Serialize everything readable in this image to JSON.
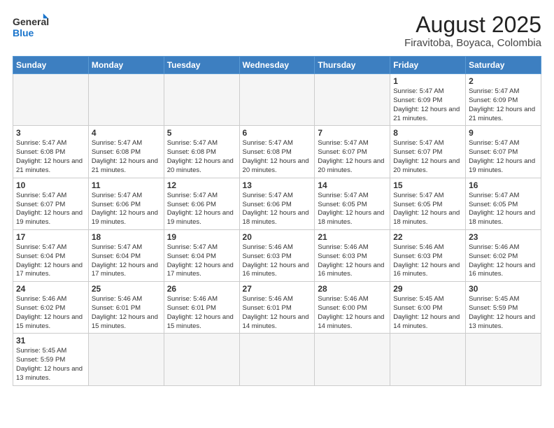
{
  "logo": {
    "text_general": "General",
    "text_blue": "Blue"
  },
  "header": {
    "title": "August 2025",
    "subtitle": "Firavitoba, Boyaca, Colombia"
  },
  "weekdays": [
    "Sunday",
    "Monday",
    "Tuesday",
    "Wednesday",
    "Thursday",
    "Friday",
    "Saturday"
  ],
  "weeks": [
    [
      {
        "day": "",
        "info": "",
        "empty": true
      },
      {
        "day": "",
        "info": "",
        "empty": true
      },
      {
        "day": "",
        "info": "",
        "empty": true
      },
      {
        "day": "",
        "info": "",
        "empty": true
      },
      {
        "day": "",
        "info": "",
        "empty": true
      },
      {
        "day": "1",
        "info": "Sunrise: 5:47 AM\nSunset: 6:09 PM\nDaylight: 12 hours\nand 21 minutes."
      },
      {
        "day": "2",
        "info": "Sunrise: 5:47 AM\nSunset: 6:09 PM\nDaylight: 12 hours\nand 21 minutes."
      }
    ],
    [
      {
        "day": "3",
        "info": "Sunrise: 5:47 AM\nSunset: 6:08 PM\nDaylight: 12 hours\nand 21 minutes."
      },
      {
        "day": "4",
        "info": "Sunrise: 5:47 AM\nSunset: 6:08 PM\nDaylight: 12 hours\nand 21 minutes."
      },
      {
        "day": "5",
        "info": "Sunrise: 5:47 AM\nSunset: 6:08 PM\nDaylight: 12 hours\nand 20 minutes."
      },
      {
        "day": "6",
        "info": "Sunrise: 5:47 AM\nSunset: 6:08 PM\nDaylight: 12 hours\nand 20 minutes."
      },
      {
        "day": "7",
        "info": "Sunrise: 5:47 AM\nSunset: 6:07 PM\nDaylight: 12 hours\nand 20 minutes."
      },
      {
        "day": "8",
        "info": "Sunrise: 5:47 AM\nSunset: 6:07 PM\nDaylight: 12 hours\nand 20 minutes."
      },
      {
        "day": "9",
        "info": "Sunrise: 5:47 AM\nSunset: 6:07 PM\nDaylight: 12 hours\nand 19 minutes."
      }
    ],
    [
      {
        "day": "10",
        "info": "Sunrise: 5:47 AM\nSunset: 6:07 PM\nDaylight: 12 hours\nand 19 minutes."
      },
      {
        "day": "11",
        "info": "Sunrise: 5:47 AM\nSunset: 6:06 PM\nDaylight: 12 hours\nand 19 minutes."
      },
      {
        "day": "12",
        "info": "Sunrise: 5:47 AM\nSunset: 6:06 PM\nDaylight: 12 hours\nand 19 minutes."
      },
      {
        "day": "13",
        "info": "Sunrise: 5:47 AM\nSunset: 6:06 PM\nDaylight: 12 hours\nand 18 minutes."
      },
      {
        "day": "14",
        "info": "Sunrise: 5:47 AM\nSunset: 6:05 PM\nDaylight: 12 hours\nand 18 minutes."
      },
      {
        "day": "15",
        "info": "Sunrise: 5:47 AM\nSunset: 6:05 PM\nDaylight: 12 hours\nand 18 minutes."
      },
      {
        "day": "16",
        "info": "Sunrise: 5:47 AM\nSunset: 6:05 PM\nDaylight: 12 hours\nand 18 minutes."
      }
    ],
    [
      {
        "day": "17",
        "info": "Sunrise: 5:47 AM\nSunset: 6:04 PM\nDaylight: 12 hours\nand 17 minutes."
      },
      {
        "day": "18",
        "info": "Sunrise: 5:47 AM\nSunset: 6:04 PM\nDaylight: 12 hours\nand 17 minutes."
      },
      {
        "day": "19",
        "info": "Sunrise: 5:47 AM\nSunset: 6:04 PM\nDaylight: 12 hours\nand 17 minutes."
      },
      {
        "day": "20",
        "info": "Sunrise: 5:46 AM\nSunset: 6:03 PM\nDaylight: 12 hours\nand 16 minutes."
      },
      {
        "day": "21",
        "info": "Sunrise: 5:46 AM\nSunset: 6:03 PM\nDaylight: 12 hours\nand 16 minutes."
      },
      {
        "day": "22",
        "info": "Sunrise: 5:46 AM\nSunset: 6:03 PM\nDaylight: 12 hours\nand 16 minutes."
      },
      {
        "day": "23",
        "info": "Sunrise: 5:46 AM\nSunset: 6:02 PM\nDaylight: 12 hours\nand 16 minutes."
      }
    ],
    [
      {
        "day": "24",
        "info": "Sunrise: 5:46 AM\nSunset: 6:02 PM\nDaylight: 12 hours\nand 15 minutes."
      },
      {
        "day": "25",
        "info": "Sunrise: 5:46 AM\nSunset: 6:01 PM\nDaylight: 12 hours\nand 15 minutes."
      },
      {
        "day": "26",
        "info": "Sunrise: 5:46 AM\nSunset: 6:01 PM\nDaylight: 12 hours\nand 15 minutes."
      },
      {
        "day": "27",
        "info": "Sunrise: 5:46 AM\nSunset: 6:01 PM\nDaylight: 12 hours\nand 14 minutes."
      },
      {
        "day": "28",
        "info": "Sunrise: 5:46 AM\nSunset: 6:00 PM\nDaylight: 12 hours\nand 14 minutes."
      },
      {
        "day": "29",
        "info": "Sunrise: 5:45 AM\nSunset: 6:00 PM\nDaylight: 12 hours\nand 14 minutes."
      },
      {
        "day": "30",
        "info": "Sunrise: 5:45 AM\nSunset: 5:59 PM\nDaylight: 12 hours\nand 13 minutes."
      }
    ],
    [
      {
        "day": "31",
        "info": "Sunrise: 5:45 AM\nSunset: 5:59 PM\nDaylight: 12 hours\nand 13 minutes."
      },
      {
        "day": "",
        "info": "",
        "empty": true
      },
      {
        "day": "",
        "info": "",
        "empty": true
      },
      {
        "day": "",
        "info": "",
        "empty": true
      },
      {
        "day": "",
        "info": "",
        "empty": true
      },
      {
        "day": "",
        "info": "",
        "empty": true
      },
      {
        "day": "",
        "info": "",
        "empty": true
      }
    ]
  ]
}
